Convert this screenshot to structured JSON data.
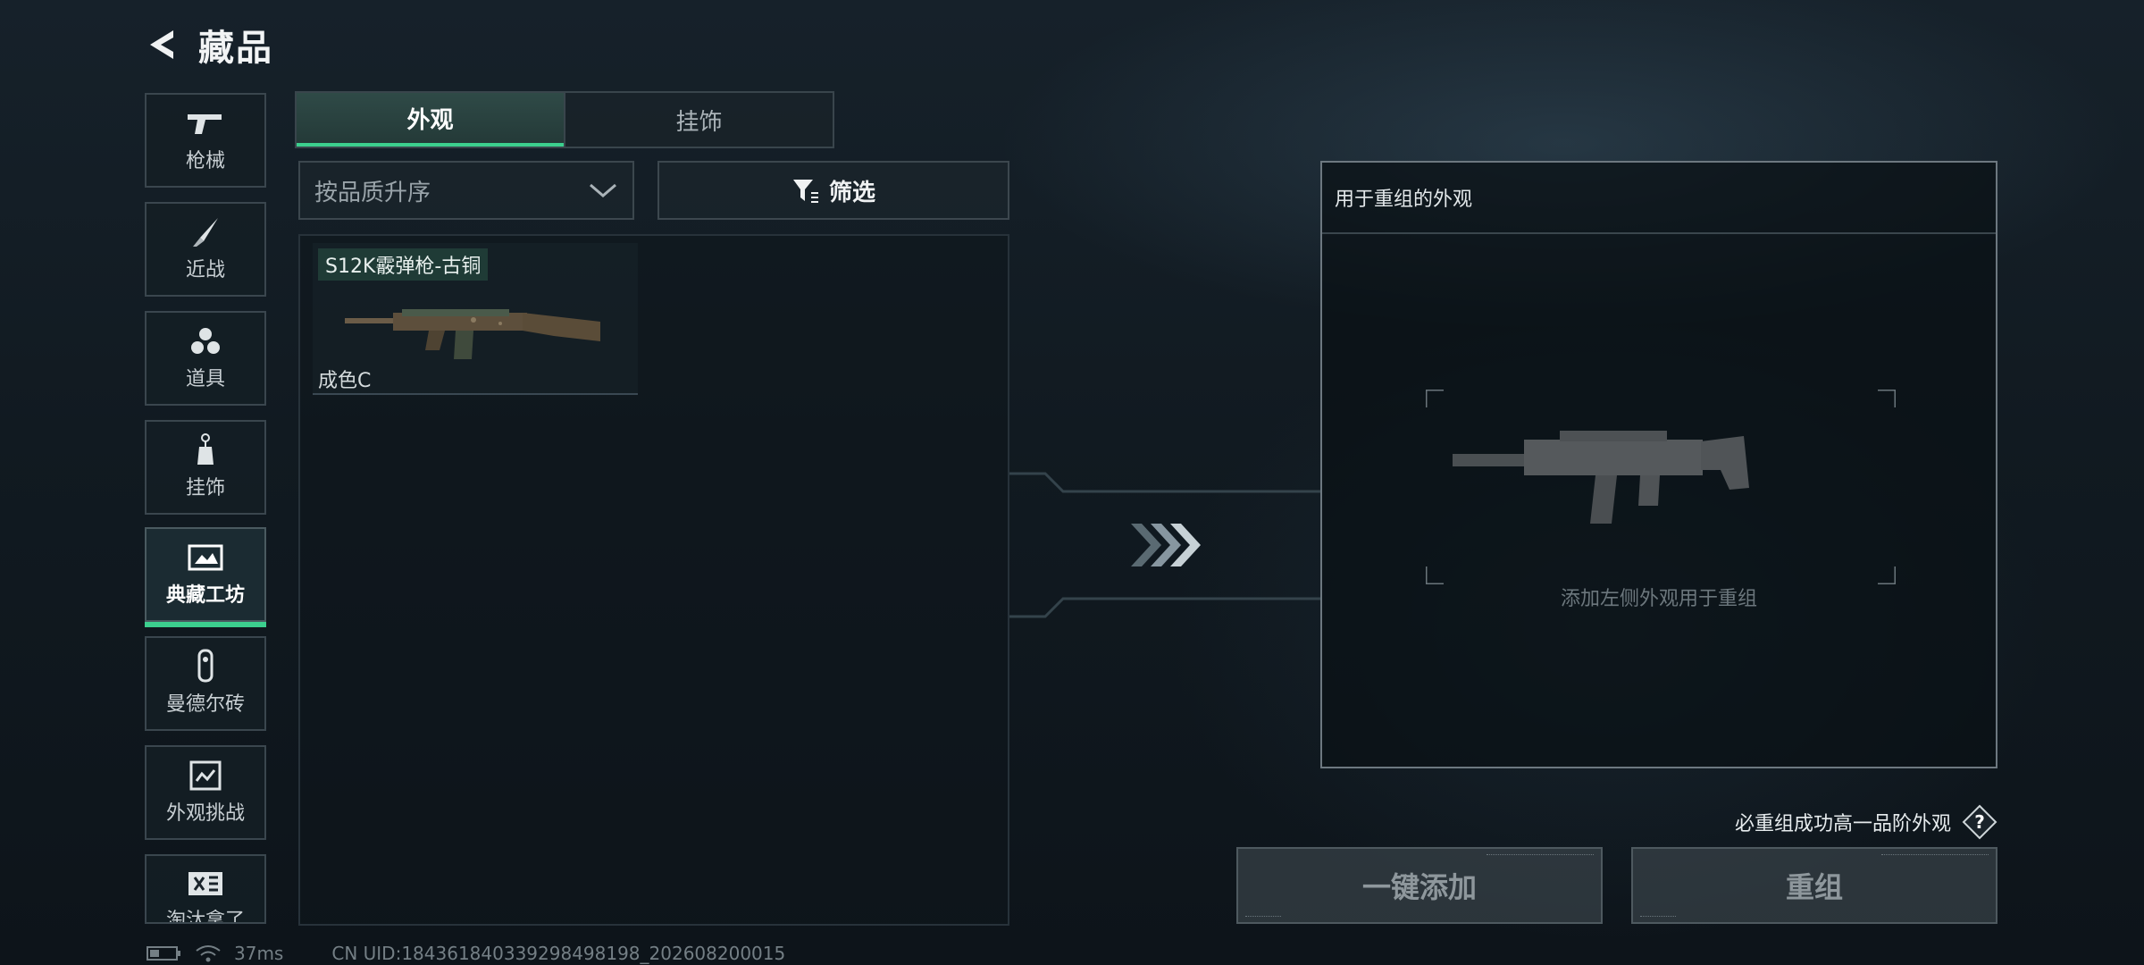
{
  "header": {
    "title": "藏品"
  },
  "sidebar": {
    "items": [
      {
        "label": "枪械",
        "icon": "pistol-icon"
      },
      {
        "label": "近战",
        "icon": "knife-icon"
      },
      {
        "label": "道具",
        "icon": "grenades-icon"
      },
      {
        "label": "挂饰",
        "icon": "charm-icon"
      },
      {
        "label": "典藏工坊",
        "icon": "workshop-icon",
        "active": true
      },
      {
        "label": "曼德尔砖",
        "icon": "brick-icon"
      },
      {
        "label": "外观挑战",
        "icon": "challenge-icon"
      },
      {
        "label": "淘汰拿了",
        "icon": "elimination-icon"
      }
    ]
  },
  "tabs": [
    {
      "label": "外观",
      "active": true
    },
    {
      "label": "挂饰",
      "active": false
    }
  ],
  "sort": {
    "label": "按品质升序"
  },
  "filter": {
    "label": "筛选"
  },
  "items": [
    {
      "name": "S12K霰弹枪-古铜",
      "condition": "成色C"
    }
  ],
  "target": {
    "title": "用于重组的外观",
    "placeholder": "添加左侧外观用于重组"
  },
  "guarantee": {
    "text": "必重组成功高一品阶外观",
    "help": "?"
  },
  "buttons": {
    "add_all": "一键添加",
    "recombine": "重组"
  },
  "status": {
    "ping": "37ms",
    "uid": "CN UID:18436184033929849819­8_202608200015"
  },
  "colors": {
    "accent": "#3ccf8e",
    "background": "#121b22"
  }
}
